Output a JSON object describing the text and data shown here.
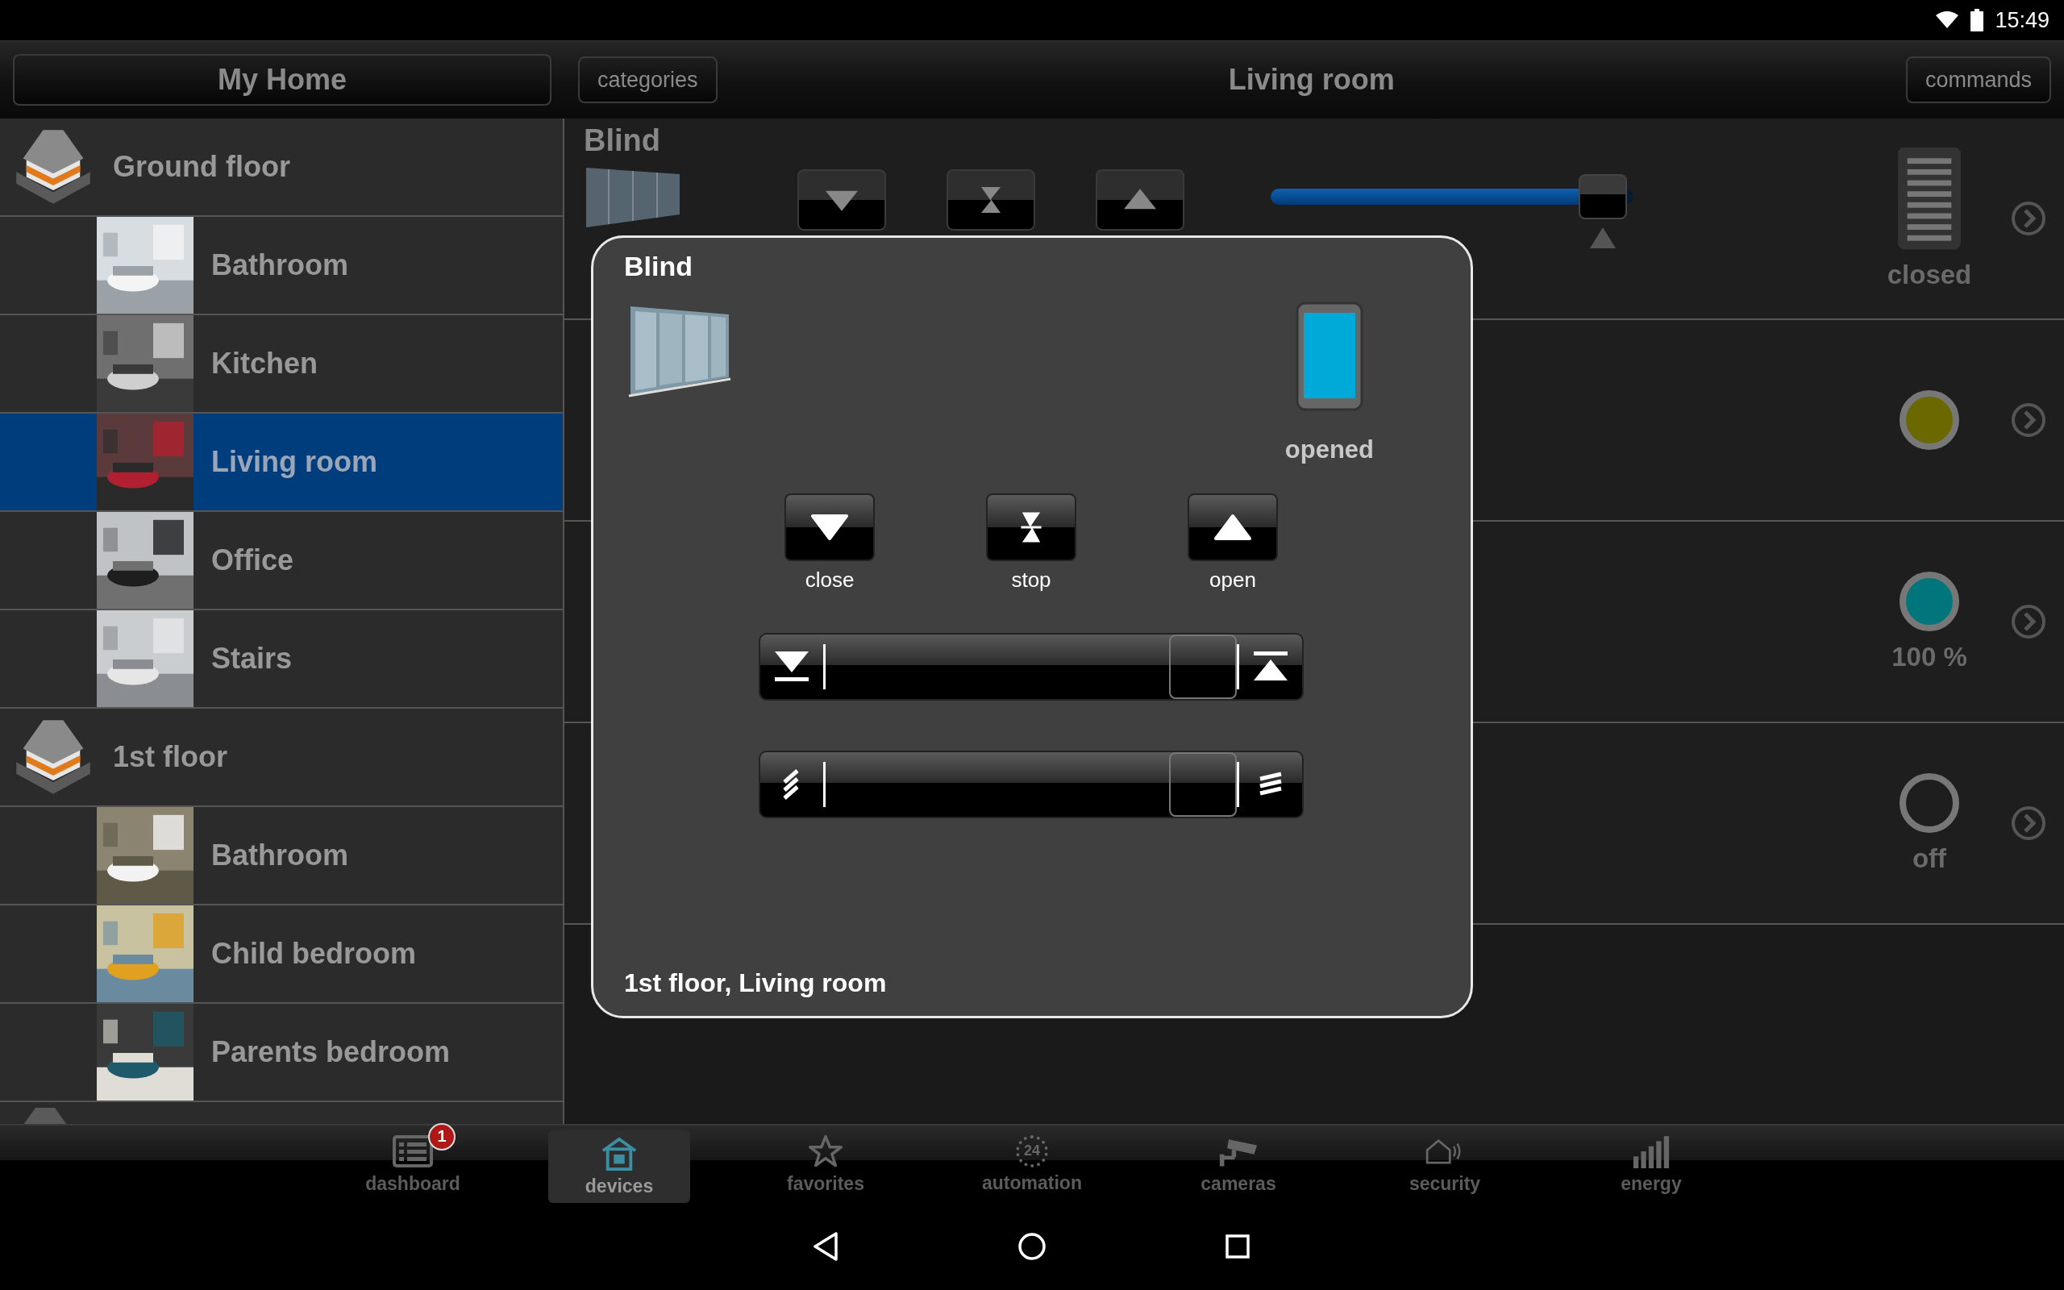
{
  "status_bar": {
    "time": "15:49"
  },
  "header": {
    "home_button": "My Home",
    "categories_button": "categories",
    "title": "Living room",
    "commands_button": "commands"
  },
  "sidebar": {
    "items": [
      {
        "kind": "floor",
        "label": "Ground floor",
        "selected": false
      },
      {
        "kind": "room",
        "label": "Bathroom",
        "selected": false
      },
      {
        "kind": "room",
        "label": "Kitchen",
        "selected": false
      },
      {
        "kind": "room",
        "label": "Living room",
        "selected": true
      },
      {
        "kind": "room",
        "label": "Office",
        "selected": false
      },
      {
        "kind": "room",
        "label": "Stairs",
        "selected": false
      },
      {
        "kind": "floor",
        "label": "1st floor",
        "selected": false
      },
      {
        "kind": "room",
        "label": "Bathroom",
        "selected": false
      },
      {
        "kind": "room",
        "label": "Child bedroom",
        "selected": false
      },
      {
        "kind": "room",
        "label": "Parents bedroom",
        "selected": false
      }
    ]
  },
  "devices": [
    {
      "kind": "blind",
      "title": "Blind",
      "level": 0.98,
      "status": "closed"
    },
    {
      "kind": "light",
      "on": true,
      "color": "#6b6800"
    },
    {
      "kind": "light",
      "on": true,
      "color": "#00767c",
      "status": "100 %"
    },
    {
      "kind": "light",
      "on": false,
      "status": "off"
    }
  ],
  "dialog": {
    "title": "Blind",
    "open": true,
    "status": "opened",
    "buttons": [
      {
        "kind": "close",
        "label": "close"
      },
      {
        "kind": "stop",
        "label": "stop"
      },
      {
        "kind": "open",
        "label": "open"
      }
    ],
    "sliders": [
      {
        "kind": "position",
        "level": 1
      },
      {
        "kind": "tilt",
        "level": 1
      }
    ],
    "footer": "1st floor, Living room"
  },
  "bottom_nav": [
    {
      "kind": "dashboard",
      "label": "dashboard",
      "badge": "1",
      "selected": false
    },
    {
      "kind": "devices",
      "label": "devices",
      "selected": true
    },
    {
      "kind": "favorites",
      "label": "favorites",
      "selected": false
    },
    {
      "kind": "automation",
      "label": "automation",
      "icon_text": "24",
      "selected": false
    },
    {
      "kind": "cameras",
      "label": "cameras",
      "selected": false
    },
    {
      "kind": "security",
      "label": "security",
      "selected": false
    },
    {
      "kind": "energy",
      "label": "energy",
      "selected": false
    }
  ]
}
